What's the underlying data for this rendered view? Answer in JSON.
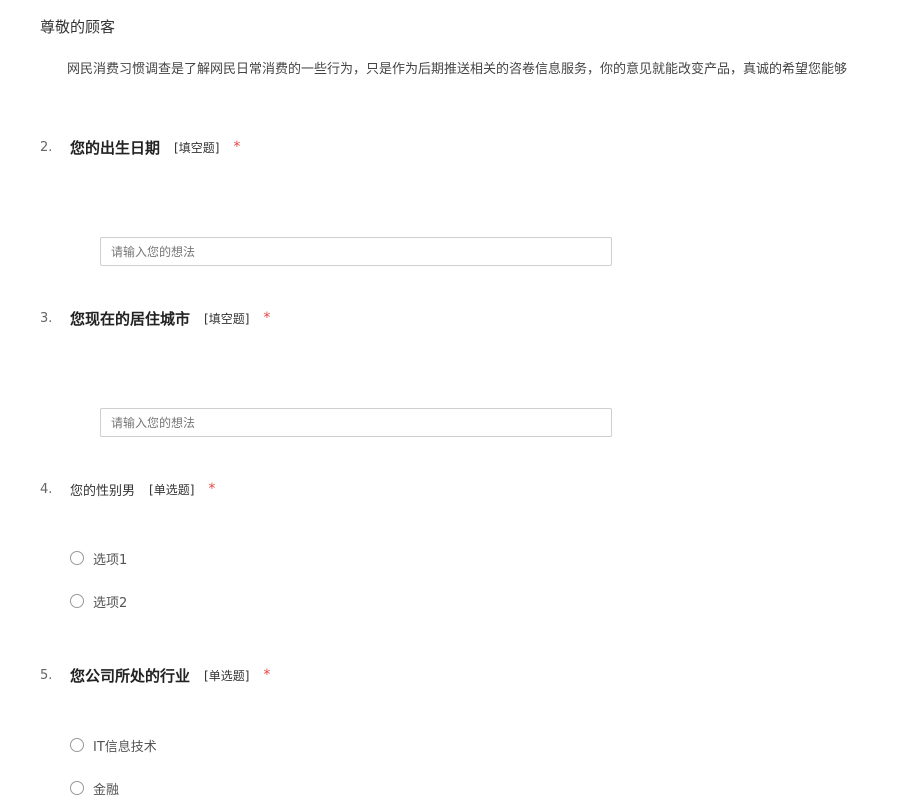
{
  "header": {
    "greeting": "尊敬的顾客",
    "intro": "网民消费习惯调查是了解网民日常消费的一些行为，只是作为后期推送相关的咨卷信息服务，你的意见就能改变产品，真诚的希望您能够"
  },
  "questions": [
    {
      "number": "2.",
      "title": "您的出生日期",
      "type": "[填空题]",
      "required": "*",
      "placeholder": "请输入您的想法"
    },
    {
      "number": "3.",
      "title": "您现在的居住城市",
      "type": "[填空题]",
      "required": "*",
      "placeholder": "请输入您的想法"
    },
    {
      "number": "4.",
      "title": "您的性别男",
      "type": "[单选题]",
      "required": "*",
      "options": [
        "选项1",
        "选项2"
      ]
    },
    {
      "number": "5.",
      "title": "您公司所处的行业",
      "type": "[单选题]",
      "required": "*",
      "options": [
        "IT信息技术",
        "金融"
      ]
    }
  ],
  "colors": {
    "required_mark": "#e84545",
    "input_border": "#cfcfcf",
    "radio_border": "#9a9a9a"
  }
}
